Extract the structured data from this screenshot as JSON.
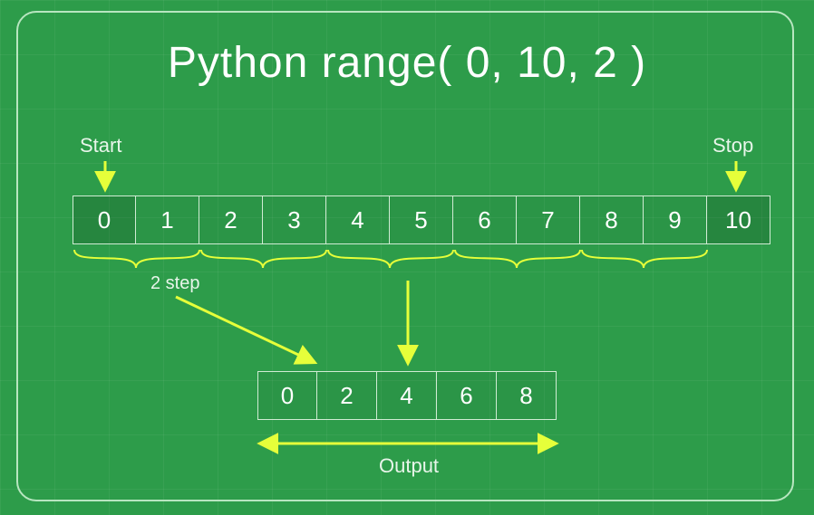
{
  "title": "Python range( 0, 10, 2 )",
  "labels": {
    "start": "Start",
    "stop": "Stop",
    "step": "2 step",
    "output": "Output"
  },
  "input_sequence": [
    {
      "v": "0",
      "highlight": true
    },
    {
      "v": "1",
      "highlight": false
    },
    {
      "v": "2",
      "highlight": false
    },
    {
      "v": "3",
      "highlight": false
    },
    {
      "v": "4",
      "highlight": false
    },
    {
      "v": "5",
      "highlight": false
    },
    {
      "v": "6",
      "highlight": false
    },
    {
      "v": "7",
      "highlight": false
    },
    {
      "v": "8",
      "highlight": false
    },
    {
      "v": "9",
      "highlight": false
    },
    {
      "v": "10",
      "highlight": true
    }
  ],
  "output_sequence": [
    "0",
    "2",
    "4",
    "6",
    "8"
  ],
  "range_args": {
    "start": 0,
    "stop": 10,
    "step": 2
  },
  "colors": {
    "bg": "#2d9c4a",
    "border": "#b8e6c0",
    "arrow": "#e6ff3a"
  }
}
